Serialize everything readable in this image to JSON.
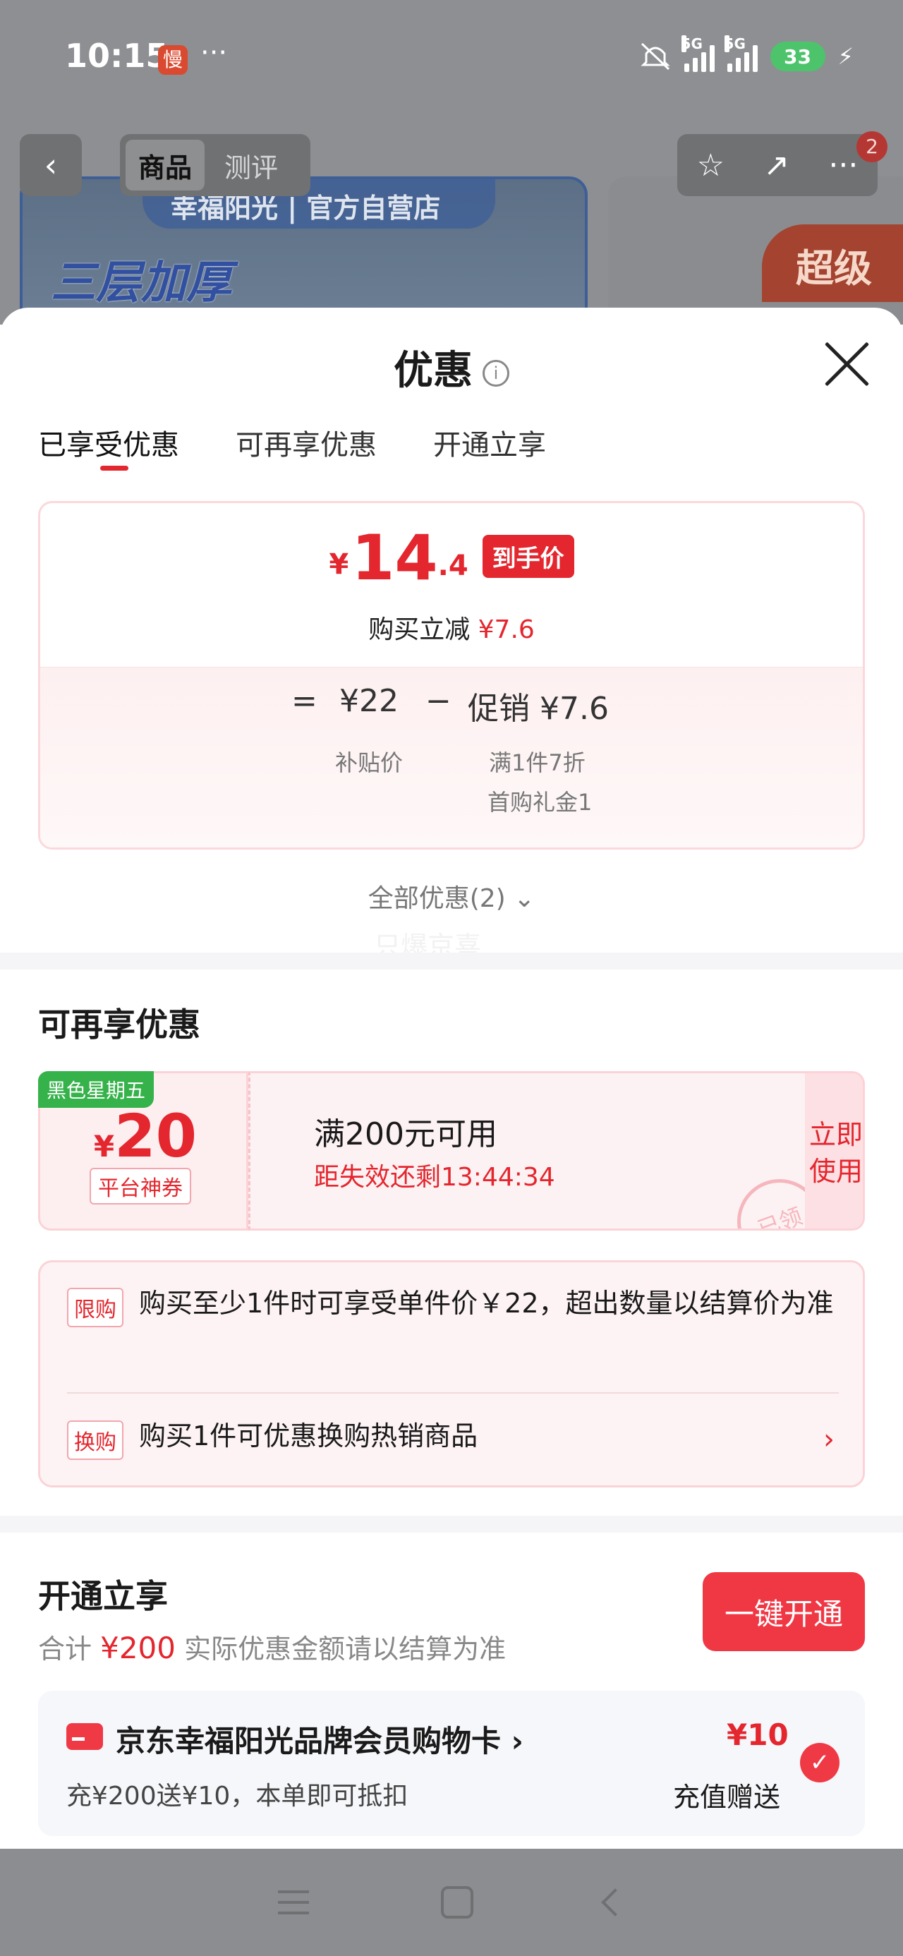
{
  "status_bar": {
    "time": "10:15",
    "slow_badge": "慢",
    "more": "···",
    "network1": "5G",
    "network2": "5G",
    "battery": "33",
    "icons": [
      "mute-icon",
      "signal-icon",
      "battery-icon",
      "charging-icon"
    ]
  },
  "background": {
    "tab_product": "商品",
    "tab_review": "测评",
    "shop_name": "幸福阳光 | 官方自营店",
    "banner_text": "三层加厚",
    "promo_text": "超级",
    "notification_count": "2"
  },
  "sheet": {
    "title": "优惠",
    "tabs": [
      "已享受优惠",
      "可再享优惠",
      "开通立享"
    ],
    "price": {
      "currency": "¥",
      "integer": "14",
      "decimal": ".4",
      "tag": "到手价",
      "reduce_label": "购买立减",
      "reduce_amount": "¥7.6"
    },
    "formula": {
      "equals": "=",
      "base": "¥22",
      "minus": "−",
      "promo": "促销 ¥7.6",
      "base_label": "补贴价",
      "promo_detail1": "满1件7折",
      "promo_detail2": "首购礼金1"
    },
    "all_discounts": "全部优惠(2)",
    "watermark": "只爆京喜"
  },
  "more_offers": {
    "title": "可再享优惠",
    "coupon": {
      "label": "黑色星期五",
      "currency": "¥",
      "amount": "20",
      "type": "平台神券",
      "condition": "满200元可用",
      "expiry": "距失效还剩13:44:34",
      "use_line1": "立即",
      "use_line2": "使用",
      "stamp": "已领"
    },
    "limits": [
      {
        "tag": "限购",
        "text": "购买至少1件时可享受单件价￥22，超出数量以结算价为准"
      },
      {
        "tag": "换购",
        "text": "购买1件可优惠换购热销商品"
      }
    ]
  },
  "open_section": {
    "title": "开通立享",
    "total_label": "合计",
    "total_amount": "¥200",
    "total_note": "实际优惠金额请以结算为准",
    "button": "一键开通",
    "card": {
      "title": "京东幸福阳光品牌会员购物卡",
      "subtitle": "充¥200送¥10，本单即可抵扣",
      "amount": "¥10",
      "amount_label": "充值赠送"
    }
  },
  "colors": {
    "accent": "#e4262e",
    "button": "#f03845",
    "badge_green": "#35b24a"
  }
}
